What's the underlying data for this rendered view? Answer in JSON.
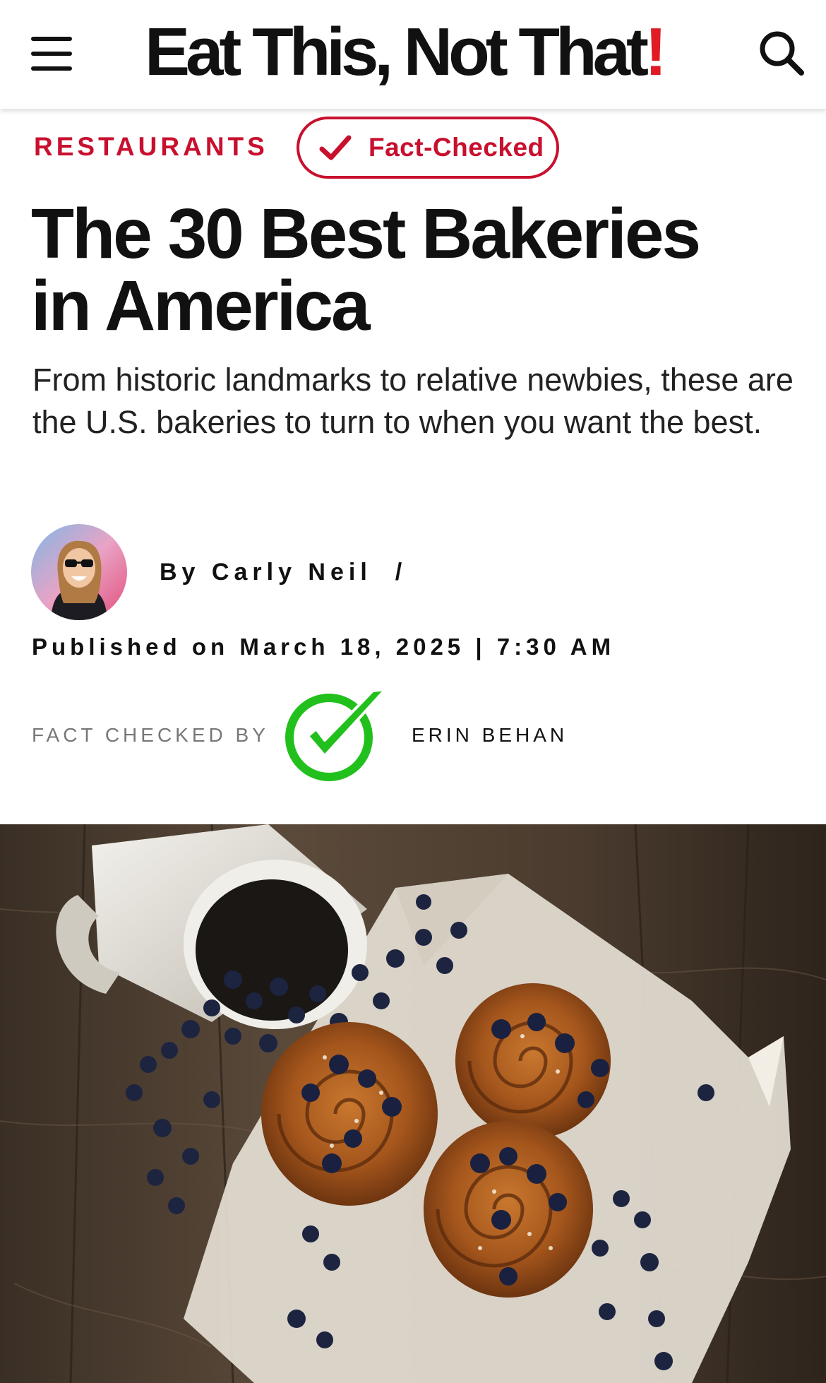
{
  "header": {
    "logo_text": "Eat This, Not That",
    "logo_mark": "!",
    "menu_icon": "hamburger-menu-icon",
    "search_icon": "search-icon"
  },
  "article": {
    "category": "RESTAURANTS",
    "fact_checked_badge": "Fact-Checked",
    "headline_line1": "The 30 Best Bakeries",
    "headline_line2": "in America",
    "subhead": "From historic landmarks to relative newbies, these are the U.S. bakeries to turn to when you want the best.",
    "byline_prefix": "By",
    "author": "Carly Neil",
    "byline_separator": "/",
    "published_label": "Published on",
    "published_date": "March 18, 2025",
    "published_separator": "|",
    "published_time": "7:30 AM",
    "fact_checked_by_label": "FACT CHECKED BY",
    "fact_checker": "ERIN BEHAN"
  },
  "colors": {
    "brand_red": "#c8102e",
    "check_green": "#22c01c",
    "text": "#111111",
    "muted": "#777777"
  }
}
